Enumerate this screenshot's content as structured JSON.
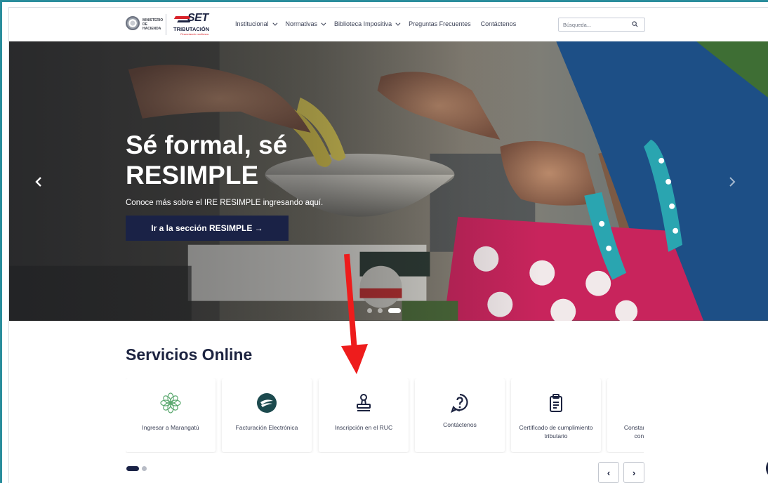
{
  "header": {
    "logo_ministry": "MINISTERIO DE HACIENDA",
    "logo_brand": "SET",
    "logo_tributacion": "TRIBUTACIÓN",
    "logo_slogan": "Financiando confianza",
    "nav": [
      {
        "label": "Institucional",
        "has_dropdown": true
      },
      {
        "label": "Normativas",
        "has_dropdown": true
      },
      {
        "label": "Biblioteca Impositiva",
        "has_dropdown": true
      },
      {
        "label": "Preguntas Frecuentes",
        "has_dropdown": false
      },
      {
        "label": "Contáctenos",
        "has_dropdown": false
      }
    ],
    "search_placeholder": "Búsqueda..."
  },
  "hero": {
    "title": "Sé formal, sé RESIMPLE",
    "subtitle": "Conoce más sobre el IRE RESIMPLE ingresando aquí.",
    "button_label": "Ir a la sección RESIMPLE →",
    "slides_total": 3,
    "active_slide": 3
  },
  "services": {
    "title": "Servicios Online",
    "cards": [
      {
        "label": "Ingresar a Marangatú",
        "icon": "marangatu-flower-icon"
      },
      {
        "label": "Facturación Electrónica",
        "icon": "facturacion-logo-icon"
      },
      {
        "label": "Inscripción en el RUC",
        "icon": "stamp-icon"
      },
      {
        "label": "Contáctenos",
        "icon": "question-circle-icon"
      },
      {
        "label": "Certificado de cumplimiento tributario",
        "icon": "clipboard-icon"
      },
      {
        "label": "Constancia de no ser contribuyente",
        "icon": "document-icon"
      }
    ],
    "pages_total": 2,
    "active_page": 1,
    "prev_label": "‹",
    "next_label": "›"
  },
  "colors": {
    "brand_navy": "#1a2246",
    "brand_red": "#d8232a",
    "frame_teal": "#2a8d9c",
    "annotation_red": "#ee1c1c"
  }
}
